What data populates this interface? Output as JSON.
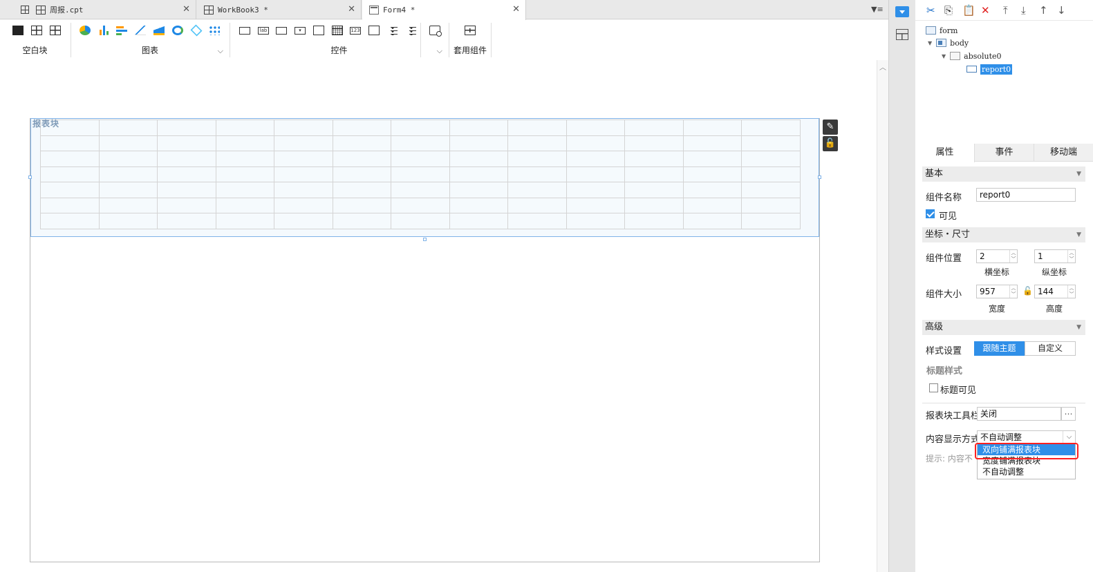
{
  "tabs": [
    {
      "label": "周报.cpt"
    },
    {
      "label": "WorkBook3 *"
    },
    {
      "label": "Form4 *"
    }
  ],
  "toolbar": {
    "groups": [
      {
        "label": "空白块"
      },
      {
        "label": "图表"
      },
      {
        "label": "控件"
      },
      {
        "label": "套用组件"
      }
    ]
  },
  "canvas": {
    "report_label": "报表块"
  },
  "tree": {
    "nodes": [
      {
        "label": "form"
      },
      {
        "label": "body"
      },
      {
        "label": "absolute0"
      },
      {
        "label": "report0"
      }
    ]
  },
  "panel": {
    "tabs": [
      "属性",
      "事件",
      "移动端"
    ],
    "basic_title": "基本",
    "name_label": "组件名称",
    "name_value": "report0",
    "visible_label": "可见",
    "coord_title": "坐标・尺寸",
    "pos_label": "组件位置",
    "pos_x": "2",
    "pos_y": "1",
    "x_label": "横坐标",
    "y_label": "纵坐标",
    "size_label": "组件大小",
    "width": "957",
    "height": "144",
    "w_label": "宽度",
    "h_label": "高度",
    "adv_title": "高级",
    "style_label": "样式设置",
    "style_opt1": "跟随主题",
    "style_opt2": "自定义",
    "title_style": "标题样式",
    "title_visible": "标题可见",
    "toolbar_label": "报表块工具栏",
    "toolbar_value": "关闭",
    "content_label": "内容显示方式",
    "content_value": "不自动调整",
    "hint": "提示: 内容不",
    "dropdown_options": [
      "双向铺满报表块",
      "宽度铺满报表块",
      "不自动调整"
    ]
  }
}
